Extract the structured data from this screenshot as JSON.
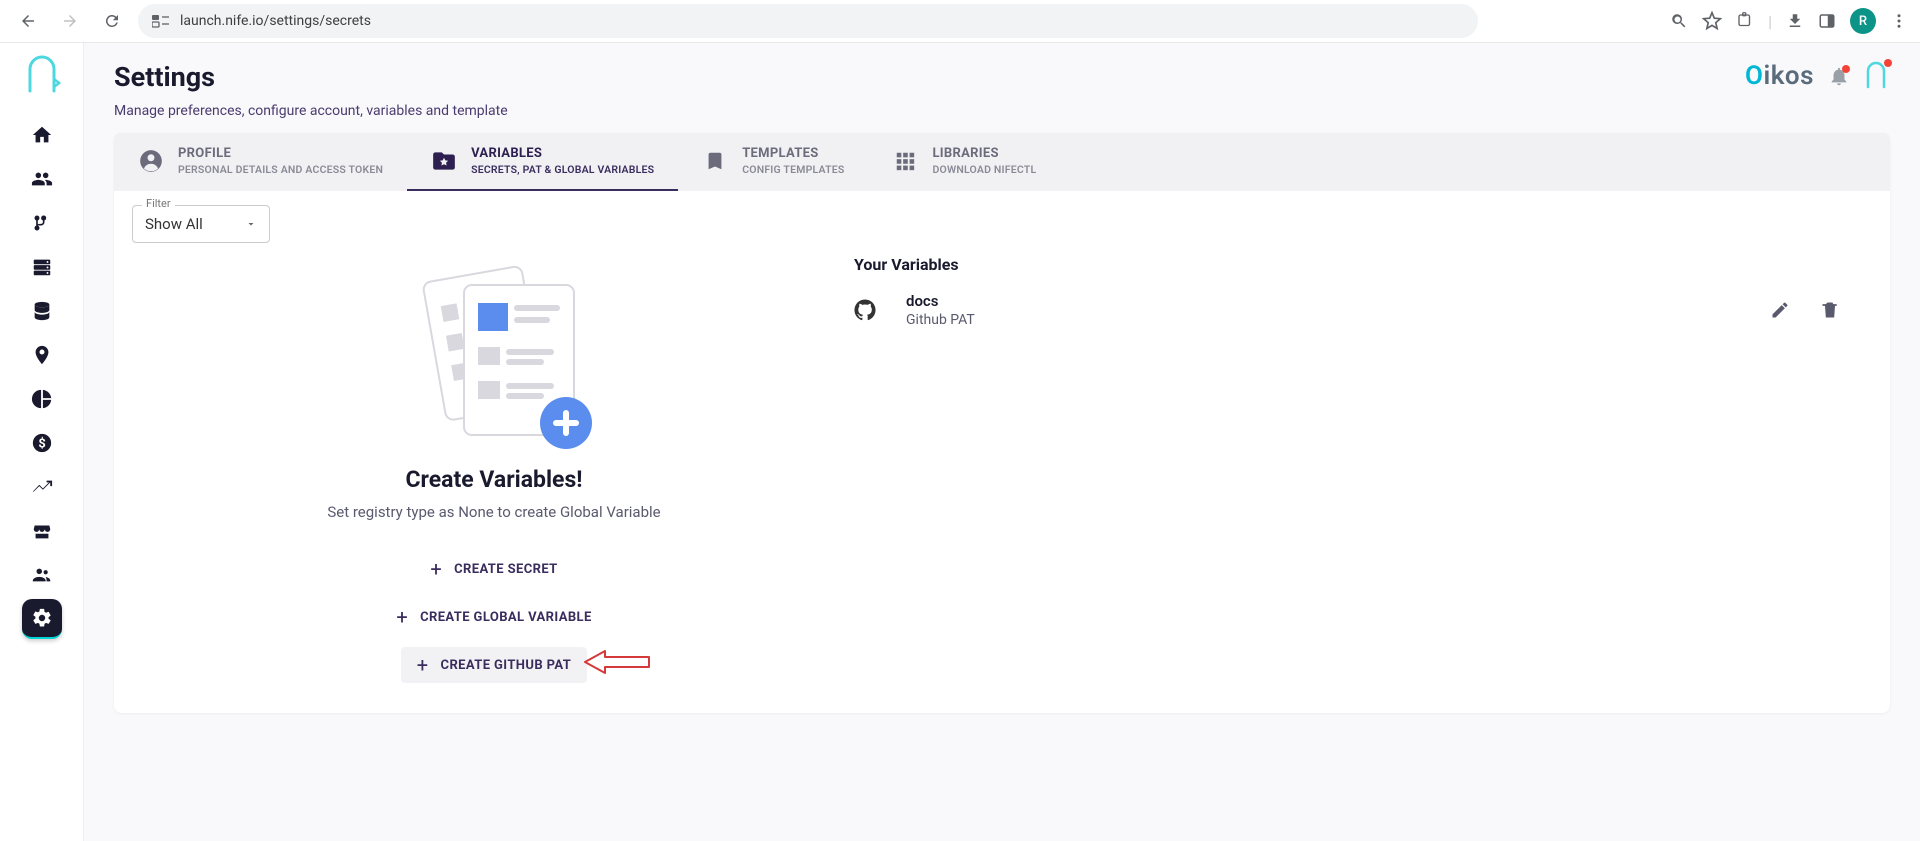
{
  "browser": {
    "url": "launch.nife.io/settings/secrets",
    "avatar_initial": "R"
  },
  "header": {
    "title": "Settings",
    "subtitle": "Manage preferences, configure account, variables and template",
    "brand_o": "O",
    "brand_rest": "ikos"
  },
  "tabs": [
    {
      "title": "PROFILE",
      "sub": "PERSONAL DETAILS AND ACCESS TOKEN",
      "icon": "user-circle"
    },
    {
      "title": "VARIABLES",
      "sub": "SECRETS, PAT & GLOBAL VARIABLES",
      "icon": "folder-star"
    },
    {
      "title": "TEMPLATES",
      "sub": "CONFIG TEMPLATES",
      "icon": "bookmark"
    },
    {
      "title": "LIBRARIES",
      "sub": "DOWNLOAD NIFECTL",
      "icon": "grid"
    }
  ],
  "filter": {
    "label": "Filter",
    "selected": "Show All"
  },
  "create_panel": {
    "heading": "Create Variables!",
    "sub": "Set registry type as None to create Global Variable",
    "buttons": [
      {
        "label": "CREATE SECRET"
      },
      {
        "label": "CREATE GLOBAL VARIABLE"
      },
      {
        "label": "CREATE GITHUB PAT"
      }
    ]
  },
  "variables_panel": {
    "heading": "Your Variables",
    "items": [
      {
        "name": "docs",
        "type": "Github PAT",
        "icon": "github"
      }
    ]
  }
}
